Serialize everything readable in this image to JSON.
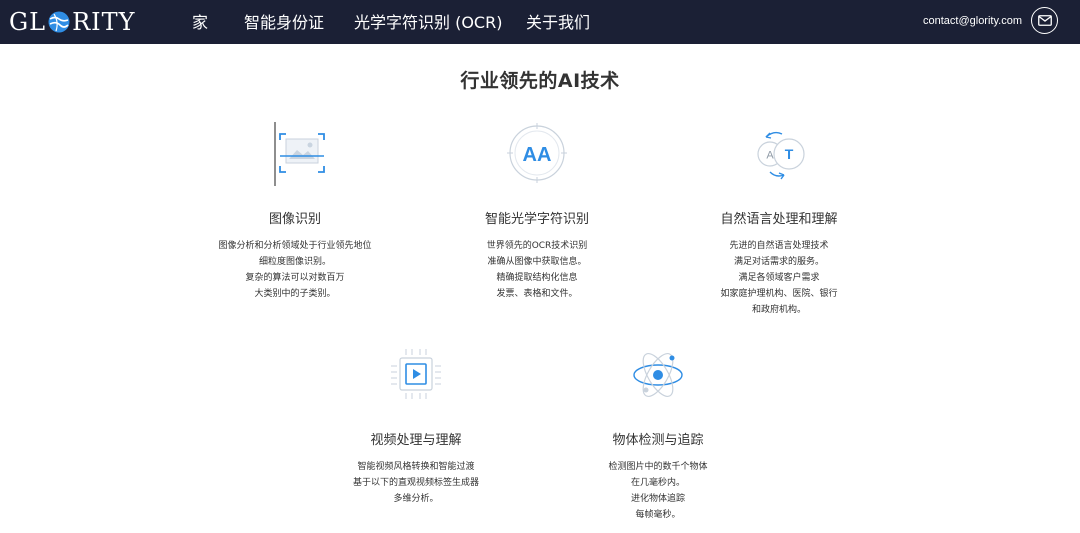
{
  "header": {
    "logo_pre": "GL",
    "logo_post": "RITY",
    "nav": [
      "家",
      "智能身份证",
      "光学字符识别 (OCR)",
      "关于我们"
    ],
    "contact_email": "contact@glority.com",
    "mail_icon": "envelope-icon",
    "colors": {
      "bar": "#1b2035",
      "text": "#ffffff"
    }
  },
  "main": {
    "heading": "行业领先的AI技术",
    "features": [
      {
        "icon": "image-frame-icon",
        "title": "图像识别",
        "lines": [
          "图像分析和分析领域处于行业领先地位",
          "细粒度图像识别。",
          "复杂的算法可以对数百万",
          "大类别中的子类别。"
        ]
      },
      {
        "icon": "ocr-aa-icon",
        "title": "智能光学字符识别",
        "lines": [
          "世界领先的OCR技术识别",
          "准确从图像中获取信息。",
          "精确提取结构化信息",
          "发票、表格和文件。"
        ]
      },
      {
        "icon": "translate-at-icon",
        "title": "自然语言处理和理解",
        "lines": [
          "先进的自然语言处理技术",
          "满足对话需求的服务。",
          "满足各领域客户需求",
          "如家庭护理机构、医院、银行",
          "和政府机构。"
        ]
      },
      {
        "icon": "video-chip-icon",
        "title": "视频处理与理解",
        "lines": [
          "智能视频风格转换和智能过渡",
          "基于以下的直观视频标签生成器",
          "多维分析。"
        ]
      },
      {
        "icon": "atom-icon",
        "title": "物体检测与追踪",
        "lines": [
          "检测图片中的数千个物体",
          "在几毫秒内。",
          "进化物体追踪",
          "每帧毫秒。"
        ]
      }
    ],
    "accent_color": "#2f8de4"
  }
}
